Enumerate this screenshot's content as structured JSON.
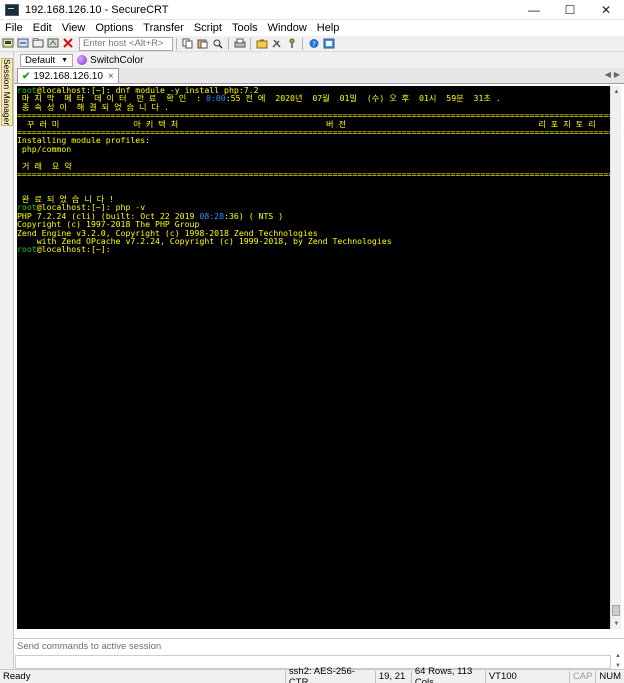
{
  "window": {
    "title": "192.168.126.10 - SecureCRT",
    "minimize": "—",
    "maximize": "☐",
    "close": "✕"
  },
  "menu": [
    "File",
    "Edit",
    "View",
    "Options",
    "Transfer",
    "Script",
    "Tools",
    "Window",
    "Help"
  ],
  "toolbar": {
    "host_placeholder": "Enter host <Alt+R>"
  },
  "session_bar": {
    "default_label": "Default",
    "switch_label": "SwitchColor"
  },
  "sidebar": {
    "label": "Session Manager"
  },
  "tab": {
    "label": "192.168.126.10",
    "close": "×",
    "status_color": "#1aa31a"
  },
  "terminal": {
    "lines": [
      {
        "parts": [
          {
            "t": "root",
            "c": "green"
          },
          {
            "t": "@localhost:[~]: dnf module -y install php:7.2",
            "c": "yellow"
          }
        ]
      },
      {
        "parts": [
          {
            "t": " 마 지 막  메 타  데 이 터  만 료  확 인  : ",
            "c": "yellow"
          },
          {
            "t": "0:00",
            "c": "blue"
          },
          {
            "t": ":55 전 에  2020년  07월  01일  (수) 오 후  01시  59분  31초 .",
            "c": "yellow"
          }
        ]
      },
      {
        "parts": [
          {
            "t": " 종 속 성 이  해 결 되 었 습 니 다 .",
            "c": "yellow"
          }
        ]
      },
      {
        "type": "rule",
        "char": "="
      },
      {
        "parts": [
          {
            "t": "  꾸 러 미               아 키 텍 처                              버 전                                       리 포 지 토 리                       크 기",
            "c": "yellow"
          }
        ]
      },
      {
        "type": "rule",
        "char": "="
      },
      {
        "parts": [
          {
            "t": "Installing module profiles:",
            "c": "yellow"
          }
        ]
      },
      {
        "parts": [
          {
            "t": " php/common",
            "c": "yellow"
          }
        ]
      },
      {
        "parts": [
          {
            "t": "",
            "c": "yellow"
          }
        ]
      },
      {
        "parts": [
          {
            "t": " 거 래  요 약",
            "c": "yellow"
          }
        ]
      },
      {
        "type": "rule",
        "char": "="
      },
      {
        "parts": [
          {
            "t": "",
            "c": "yellow"
          }
        ]
      },
      {
        "parts": [
          {
            "t": "",
            "c": "yellow"
          }
        ]
      },
      {
        "parts": [
          {
            "t": " 완 료 되 었 습 니 다 !",
            "c": "yellow"
          }
        ]
      },
      {
        "parts": [
          {
            "t": "root",
            "c": "green"
          },
          {
            "t": "@localhost:[~]: php -v",
            "c": "yellow"
          }
        ]
      },
      {
        "parts": [
          {
            "t": "PHP 7.2.24 (cli) (built: Oct 22 2019 ",
            "c": "yellow"
          },
          {
            "t": "08:28",
            "c": "blue"
          },
          {
            "t": ":36) ( NTS )",
            "c": "yellow"
          }
        ]
      },
      {
        "parts": [
          {
            "t": "Copyright (c) 1997-2018 The PHP Group",
            "c": "yellow"
          }
        ]
      },
      {
        "parts": [
          {
            "t": "Zend Engine v3.2.0, Copyright (c) 1998-2018 Zend Technologies",
            "c": "yellow"
          }
        ]
      },
      {
        "parts": [
          {
            "t": "    with Zend OPcache v7.2.24, Copyright (c) 1999-2018, by Zend Technologies",
            "c": "yellow"
          }
        ]
      },
      {
        "parts": [
          {
            "t": "root",
            "c": "green"
          },
          {
            "t": "@localhost:[~]:",
            "c": "yellow"
          }
        ]
      }
    ]
  },
  "command_window": {
    "placeholder": "Send commands to active session"
  },
  "status": {
    "ready": "Ready",
    "cipher": "ssh2: AES-256-CTR",
    "cursor": "19, 21",
    "size": "64 Rows, 113 Cols",
    "emulation": "VT100",
    "caps": "CAP",
    "num": "NUM"
  }
}
